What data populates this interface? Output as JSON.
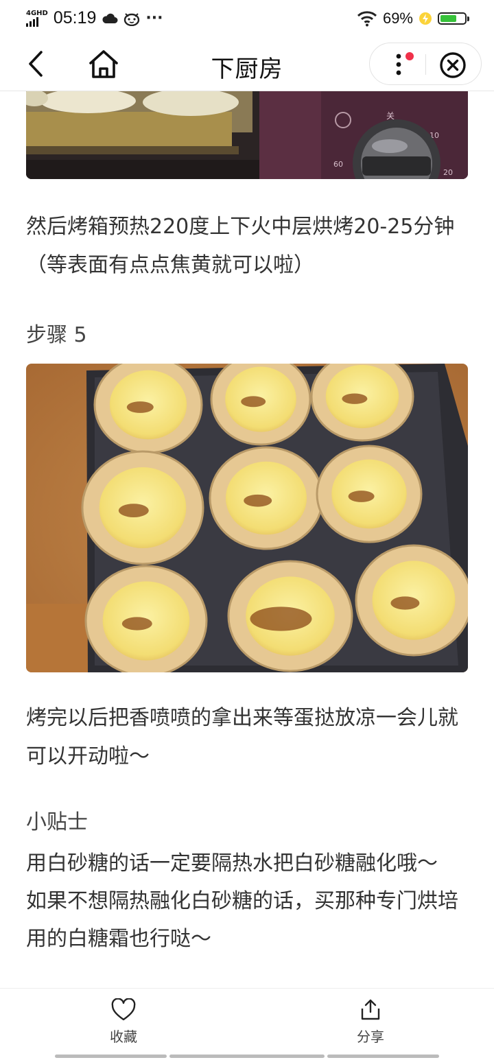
{
  "status_bar": {
    "network": "4GHD",
    "time": "05:19",
    "more": "···",
    "battery_text": "69%",
    "battery_level": 0.69,
    "battery_color": "#37c23a"
  },
  "nav": {
    "title": "下厨房"
  },
  "article": {
    "step_text_4": "然后烤箱预热220度上下火中层烘烤20-25分钟（等表面有点点焦黄就可以啦）",
    "step_5_heading": "步骤 5",
    "step_text_5": "烤完以后把香喷喷的拿出来等蛋挞放凉一会儿就可以开动啦～",
    "tips_heading": "小贴士",
    "tips_text": "用白砂糖的话一定要隔热水把白砂糖融化哦～\n如果不想隔热融化白砂糖的话，买那种专门烘培用的白糖霜也行哒～"
  },
  "bottom_bar": {
    "favorite_label": "收藏",
    "share_label": "分享"
  },
  "colors": {
    "notification_dot": "#f0314a"
  }
}
